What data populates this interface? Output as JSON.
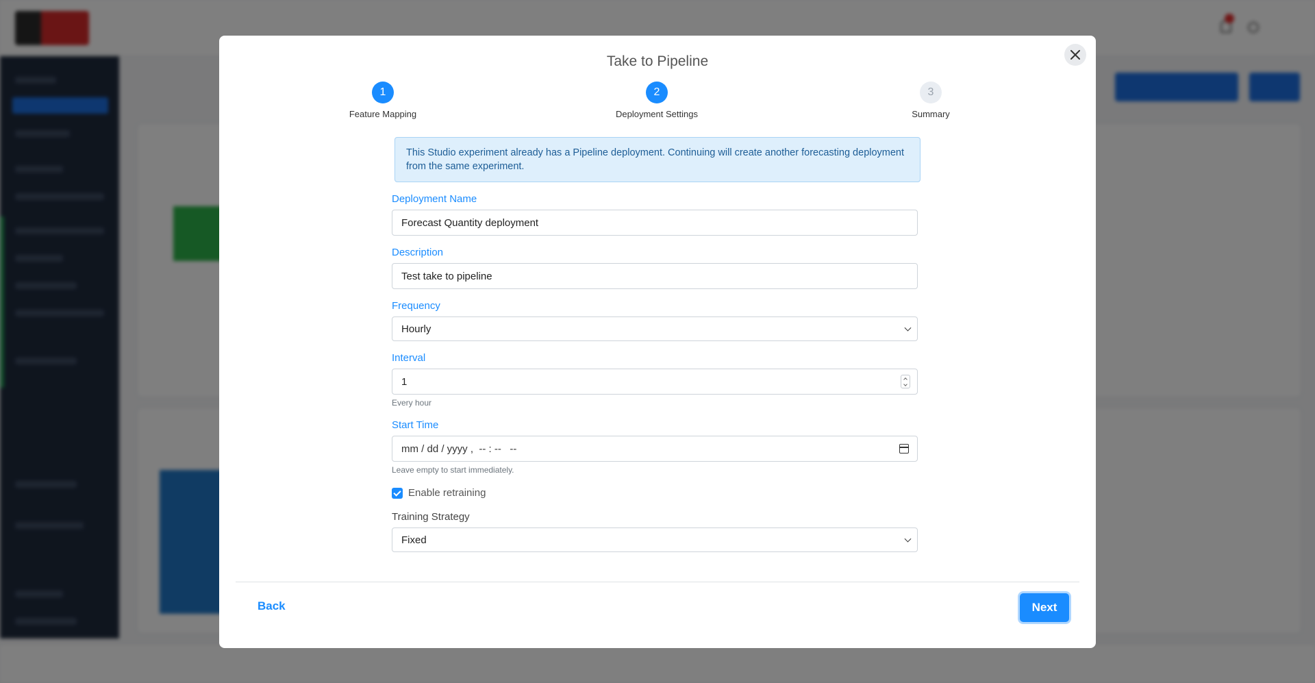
{
  "modal": {
    "title": "Take to Pipeline",
    "close_icon": "close-icon",
    "steps": [
      {
        "number": "1",
        "label": "Feature Mapping",
        "state": "done"
      },
      {
        "number": "2",
        "label": "Deployment Settings",
        "state": "current"
      },
      {
        "number": "3",
        "label": "Summary",
        "state": "pending"
      }
    ],
    "alert": "This Studio experiment already has a Pipeline deployment. Continuing will create another forecasting deployment from the same experiment.",
    "fields": {
      "deployment_name": {
        "label": "Deployment Name",
        "value": "Forecast Quantity deployment"
      },
      "description": {
        "label": "Description",
        "value": "Test take to pipeline"
      },
      "frequency": {
        "label": "Frequency",
        "value": "Hourly"
      },
      "interval": {
        "label": "Interval",
        "value": "1",
        "hint": "Every hour"
      },
      "start_time": {
        "label": "Start Time",
        "placeholder": "mm / dd / yyyy ,  -- : --   --",
        "hint": "Leave empty to start immediately."
      },
      "enable_retraining": {
        "label": "Enable retraining",
        "checked": true
      },
      "training_strategy": {
        "label": "Training Strategy",
        "value": "Fixed"
      }
    },
    "footer": {
      "back_label": "Back",
      "next_label": "Next"
    }
  },
  "colors": {
    "accent": "#1a8cff",
    "alert_bg": "#deeffc",
    "alert_text": "#1d5d96",
    "step_pending": "#e9edf2"
  }
}
